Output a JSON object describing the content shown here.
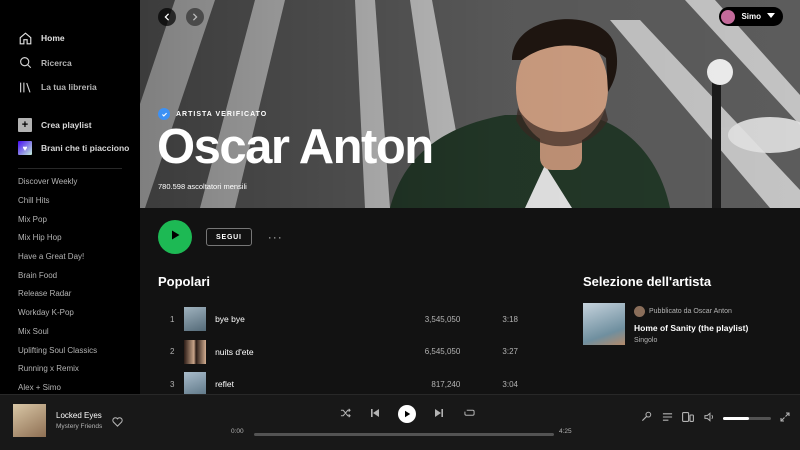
{
  "sidebar": {
    "nav": [
      {
        "label": "Home",
        "icon": "home-icon"
      },
      {
        "label": "Ricerca",
        "icon": "search-icon"
      },
      {
        "label": "La tua libreria",
        "icon": "library-icon"
      }
    ],
    "create_playlist": "Crea playlist",
    "liked_songs": "Brani che ti piacciono",
    "playlists": [
      "Discover Weekly",
      "Chill Hits",
      "Mix Pop",
      "Mix Hip Hop",
      "Have a Great Day!",
      "Brain Food",
      "Release Radar",
      "Workday K-Pop",
      "Mix Soul",
      "Uplifting Soul Classics",
      "Running x Remix",
      "Alex + Simo"
    ]
  },
  "header": {
    "user_name": "Simo",
    "verified_label": "ARTISTA VERIFICATO",
    "artist_name": "Oscar Anton",
    "monthly_listeners": "780.598 ascoltatori mensili"
  },
  "actions": {
    "follow_label": "SEGUI",
    "more_label": "···"
  },
  "popular": {
    "title": "Popolari",
    "tracks": [
      {
        "num": "1",
        "title": "bye bye",
        "plays": "3,545,050",
        "duration": "3:18"
      },
      {
        "num": "2",
        "title": "nuits d'ete",
        "plays": "6,545,050",
        "duration": "3:27"
      },
      {
        "num": "3",
        "title": "reflet",
        "plays": "817,240",
        "duration": "3:04"
      }
    ]
  },
  "artist_pick": {
    "title": "Selezione dell'artista",
    "published_by": "Pubblicato da Oscar Anton",
    "name": "Home of Sanity (the playlist)",
    "type": "Singolo"
  },
  "player": {
    "track_title": "Locked Eyes",
    "track_artist": "Mystery Friends",
    "elapsed": "0:00",
    "total": "4:25",
    "progress_fraction": 0.0,
    "volume_fraction": 0.55
  },
  "colors": {
    "accent": "#1db954",
    "background": "#121212",
    "sidebar": "#000000",
    "player": "#181818",
    "verified": "#3d91f4"
  }
}
